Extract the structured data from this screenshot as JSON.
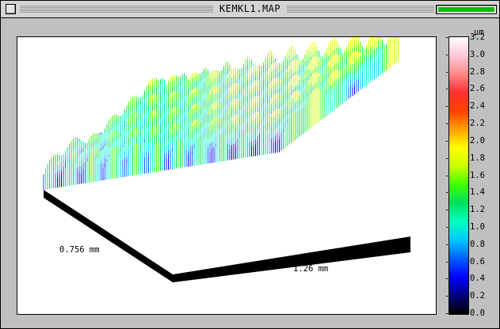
{
  "window": {
    "title": "KEMKL1.MAP",
    "progress": 1.0,
    "progress_color": "#00c000"
  },
  "icons": {
    "close": "close-box-icon"
  },
  "plot": {
    "x_extent_label": "1.26 mm",
    "y_extent_label": "0.756 mm"
  },
  "color_scale": {
    "unit": "µm",
    "min": 0.0,
    "max": 3.2,
    "ticks": [
      "3.2",
      "3.0",
      "2.8",
      "2.6",
      "2.4",
      "2.2",
      "2.0",
      "1.8",
      "1.6",
      "1.4",
      "1.2",
      "1.0",
      "0.8",
      "0.6",
      "0.4",
      "0.2",
      "0.0"
    ],
    "colors": [
      "#000000",
      "#000080",
      "#0000ff",
      "#0060ff",
      "#00c8ff",
      "#00ffc0",
      "#00e060",
      "#40ff00",
      "#c8ff00",
      "#ffff00",
      "#ffa000",
      "#ff4000",
      "#ff3030",
      "#ff8888",
      "#ffc8d8",
      "#ffffff"
    ]
  }
}
